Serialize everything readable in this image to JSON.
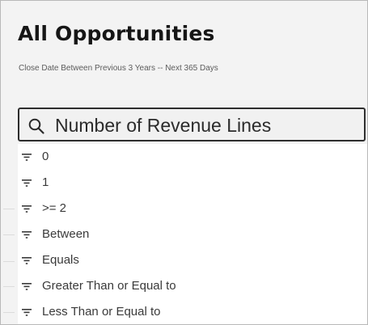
{
  "page": {
    "title": "All Opportunities",
    "subtitle": "Close Date Between Previous 3 Years -- Next 365 Days"
  },
  "search": {
    "value": "Number of Revenue Lines",
    "icon": "search-icon"
  },
  "filter_options": [
    {
      "label": "0",
      "icon": "filter-icon"
    },
    {
      "label": "1",
      "icon": "filter-icon"
    },
    {
      "label": ">= 2",
      "icon": "filter-icon"
    },
    {
      "label": "Between",
      "icon": "filter-icon"
    },
    {
      "label": "Equals",
      "icon": "filter-icon"
    },
    {
      "label": "Greater Than or Equal to",
      "icon": "filter-icon"
    },
    {
      "label": "Less Than or Equal to",
      "icon": "filter-icon"
    }
  ],
  "colors": {
    "background": "#f3f3f3",
    "list_background": "#ffffff",
    "border": "#2e2e2e",
    "title_text": "#161616"
  }
}
